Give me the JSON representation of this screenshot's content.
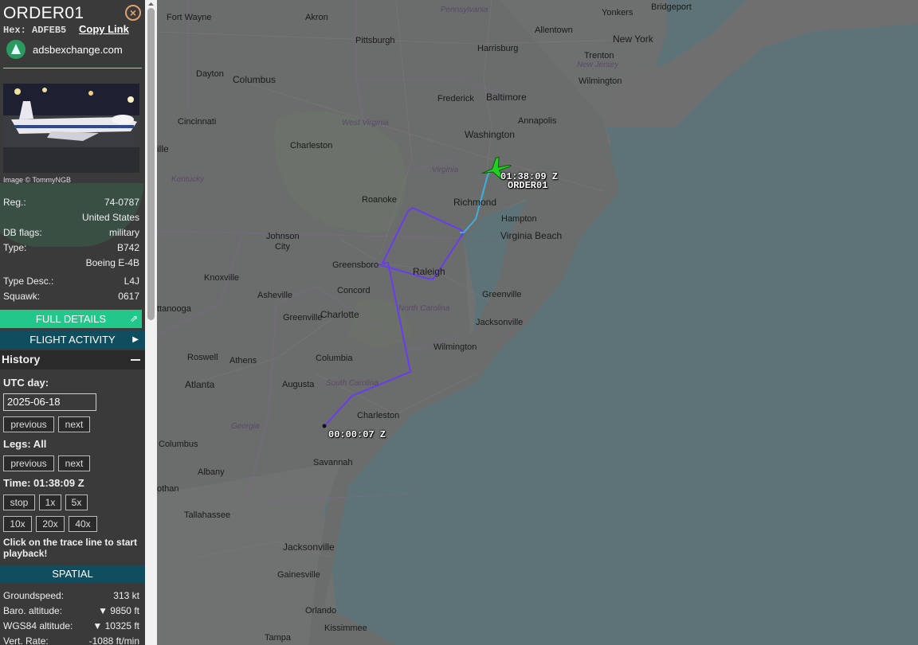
{
  "aircraft": {
    "callsign": "ORDER01",
    "hex_label": "Hex:",
    "hex": "ADFEB5",
    "copy_link": "Copy Link",
    "source": "adsbexchange.com",
    "image_credit": "Image © TommyNGB"
  },
  "details": [
    {
      "key": "Reg.:",
      "value": "74-0787"
    },
    {
      "key": "",
      "value": "United States"
    },
    {
      "key": "DB flags:",
      "value": "military"
    },
    {
      "key": "Type:",
      "value": "B742"
    },
    {
      "key": "",
      "value": "Boeing E-4B"
    },
    {
      "key": "Type Desc.:",
      "value": "L4J"
    },
    {
      "key": "Squawk:",
      "value": "0617"
    }
  ],
  "buttons": {
    "full_details": "FULL DETAILS",
    "flight_activity": "FLIGHT ACTIVITY"
  },
  "history": {
    "title": "History",
    "utc_day_label": "UTC day:",
    "date": "2025-06-18",
    "previous": "previous",
    "next": "next",
    "legs_label": "Legs: All",
    "time_label": "Time: 01:38:09 Z",
    "stop": "stop",
    "speed_1x": "1x",
    "speed_5x": "5x",
    "speed_10x": "10x",
    "speed_20x": "20x",
    "speed_40x": "40x",
    "note": "Click on the trace line to start playback!"
  },
  "spatial": {
    "title": "SPATIAL",
    "rows": [
      {
        "key": "Groundspeed:",
        "value": "313 kt"
      },
      {
        "key": "Baro. altitude:",
        "value": "▼ 9850 ft"
      },
      {
        "key": "WGS84 altitude:",
        "value": "▼ 10325 ft"
      },
      {
        "key": "Vert. Rate:",
        "value": "-1088 ft/min"
      }
    ]
  },
  "map": {
    "end_time_label": "01:38:09 Z",
    "start_time_label": "00:00:07 Z",
    "aircraft_label": "ORDER01",
    "places": {
      "fort_wayne": "Fort Wayne",
      "akron": "Akron",
      "pittsburgh": "Pittsburgh",
      "pennsylvania": "Pennsylvania",
      "allentown": "Allentown",
      "yonkers": "Yonkers",
      "bridgeport": "Bridgeport",
      "new_york": "New York",
      "harrisburg": "Harrisburg",
      "new_jersey": "New Jersey",
      "trenton": "Trenton",
      "dayton": "Dayton",
      "columbus_oh": "Columbus",
      "wilmington_de": "Wilmington",
      "frederick": "Frederick",
      "baltimore": "Baltimore",
      "annapolis": "Annapolis",
      "cincinnati": "Cincinnati",
      "washington": "Washington",
      "west_virginia": "West Virginia",
      "charleston_wv": "Charleston",
      "ille": "ille",
      "kentucky": "Kentucky",
      "virginia": "Virginia",
      "richmond": "Richmond",
      "roanoke": "Roanoke",
      "hampton": "Hampton",
      "virginia_beach": "Virginia Beach",
      "johnson_city_1": "Johnson",
      "johnson_city_2": "City",
      "greensboro": "Greensboro",
      "raleigh": "Raleigh",
      "knoxville": "Knoxville",
      "asheville": "Asheville",
      "concord": "Concord",
      "greenville_nc": "Greenville",
      "north_carolina": "North Carolina",
      "charlotte": "Charlotte",
      "greenville_sc": "Greenville",
      "jacksonville_nc": "Jacksonville",
      "tanooga": "ttanooga",
      "wilmington_nc": "Wilmington",
      "roswell": "Roswell",
      "athens": "Athens",
      "columbia": "Columbia",
      "atlanta": "Atlanta",
      "augusta": "Augusta",
      "south_carolina": "South Carolina",
      "charleston_sc": "Charleston",
      "georgia": "Georgia",
      "columbus_ga": "Columbus",
      "savannah": "Savannah",
      "albany": "Albany",
      "othan": "othan",
      "tallahassee": "Tallahassee",
      "jacksonville_fl": "Jacksonville",
      "gainesville": "Gainesville",
      "orlando": "Orlando",
      "kissimmee": "Kissimmee",
      "tampa": "Tampa"
    }
  },
  "colors": {
    "track_primary": "#6a3cf0",
    "track_recent": "#3ab0e0",
    "aircraft_icon": "#22d022",
    "full_details_button": "#22c88a",
    "section_header": "#0e4e5e"
  }
}
